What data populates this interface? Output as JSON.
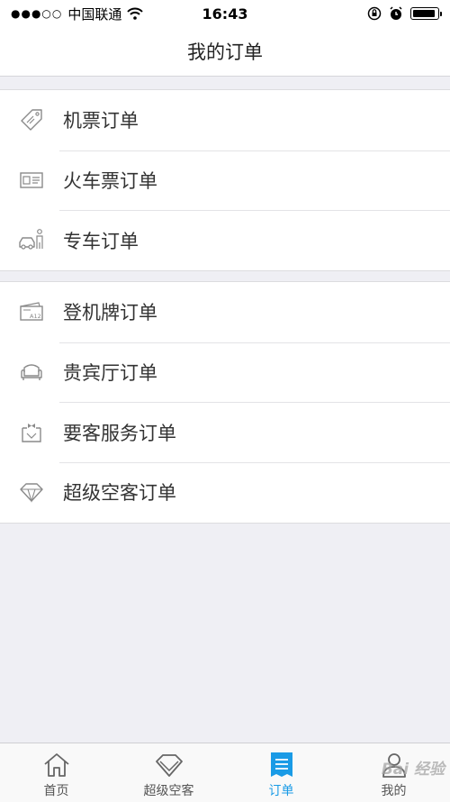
{
  "status_bar": {
    "signal": "●●●○○",
    "carrier": "中国联通",
    "time": "16:43"
  },
  "nav": {
    "title": "我的订单"
  },
  "groups": [
    {
      "items": [
        {
          "label": "机票订单",
          "icon": "ticket-icon"
        },
        {
          "label": "火车票订单",
          "icon": "train-ticket-icon"
        },
        {
          "label": "专车订单",
          "icon": "car-icon"
        }
      ]
    },
    {
      "items": [
        {
          "label": "登机牌订单",
          "icon": "boarding-pass-icon"
        },
        {
          "label": "贵宾厅订单",
          "icon": "sofa-icon"
        },
        {
          "label": "要客服务订单",
          "icon": "vip-service-icon"
        },
        {
          "label": "超级空客订单",
          "icon": "diamond-icon"
        }
      ]
    }
  ],
  "boarding_pass_code": "A12",
  "tab_bar": {
    "tabs": [
      {
        "label": "首页",
        "icon": "home-icon"
      },
      {
        "label": "超级空客",
        "icon": "diamond-icon"
      },
      {
        "label": "订单",
        "icon": "orders-icon",
        "active": true
      },
      {
        "label": "我的",
        "icon": "user-icon"
      }
    ],
    "active_color": "#1a9be6"
  },
  "watermark": "Bai 经验"
}
